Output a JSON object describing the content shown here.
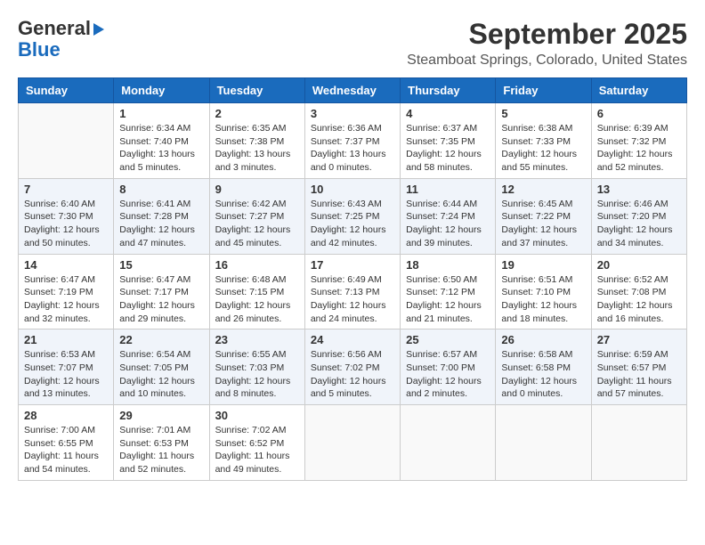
{
  "logo": {
    "line1": "General",
    "line2": "Blue"
  },
  "title": "September 2025",
  "subtitle": "Steamboat Springs, Colorado, United States",
  "weekdays": [
    "Sunday",
    "Monday",
    "Tuesday",
    "Wednesday",
    "Thursday",
    "Friday",
    "Saturday"
  ],
  "weeks": [
    [
      {
        "day": "",
        "info": ""
      },
      {
        "day": "1",
        "info": "Sunrise: 6:34 AM\nSunset: 7:40 PM\nDaylight: 13 hours\nand 5 minutes."
      },
      {
        "day": "2",
        "info": "Sunrise: 6:35 AM\nSunset: 7:38 PM\nDaylight: 13 hours\nand 3 minutes."
      },
      {
        "day": "3",
        "info": "Sunrise: 6:36 AM\nSunset: 7:37 PM\nDaylight: 13 hours\nand 0 minutes."
      },
      {
        "day": "4",
        "info": "Sunrise: 6:37 AM\nSunset: 7:35 PM\nDaylight: 12 hours\nand 58 minutes."
      },
      {
        "day": "5",
        "info": "Sunrise: 6:38 AM\nSunset: 7:33 PM\nDaylight: 12 hours\nand 55 minutes."
      },
      {
        "day": "6",
        "info": "Sunrise: 6:39 AM\nSunset: 7:32 PM\nDaylight: 12 hours\nand 52 minutes."
      }
    ],
    [
      {
        "day": "7",
        "info": "Sunrise: 6:40 AM\nSunset: 7:30 PM\nDaylight: 12 hours\nand 50 minutes."
      },
      {
        "day": "8",
        "info": "Sunrise: 6:41 AM\nSunset: 7:28 PM\nDaylight: 12 hours\nand 47 minutes."
      },
      {
        "day": "9",
        "info": "Sunrise: 6:42 AM\nSunset: 7:27 PM\nDaylight: 12 hours\nand 45 minutes."
      },
      {
        "day": "10",
        "info": "Sunrise: 6:43 AM\nSunset: 7:25 PM\nDaylight: 12 hours\nand 42 minutes."
      },
      {
        "day": "11",
        "info": "Sunrise: 6:44 AM\nSunset: 7:24 PM\nDaylight: 12 hours\nand 39 minutes."
      },
      {
        "day": "12",
        "info": "Sunrise: 6:45 AM\nSunset: 7:22 PM\nDaylight: 12 hours\nand 37 minutes."
      },
      {
        "day": "13",
        "info": "Sunrise: 6:46 AM\nSunset: 7:20 PM\nDaylight: 12 hours\nand 34 minutes."
      }
    ],
    [
      {
        "day": "14",
        "info": "Sunrise: 6:47 AM\nSunset: 7:19 PM\nDaylight: 12 hours\nand 32 minutes."
      },
      {
        "day": "15",
        "info": "Sunrise: 6:47 AM\nSunset: 7:17 PM\nDaylight: 12 hours\nand 29 minutes."
      },
      {
        "day": "16",
        "info": "Sunrise: 6:48 AM\nSunset: 7:15 PM\nDaylight: 12 hours\nand 26 minutes."
      },
      {
        "day": "17",
        "info": "Sunrise: 6:49 AM\nSunset: 7:13 PM\nDaylight: 12 hours\nand 24 minutes."
      },
      {
        "day": "18",
        "info": "Sunrise: 6:50 AM\nSunset: 7:12 PM\nDaylight: 12 hours\nand 21 minutes."
      },
      {
        "day": "19",
        "info": "Sunrise: 6:51 AM\nSunset: 7:10 PM\nDaylight: 12 hours\nand 18 minutes."
      },
      {
        "day": "20",
        "info": "Sunrise: 6:52 AM\nSunset: 7:08 PM\nDaylight: 12 hours\nand 16 minutes."
      }
    ],
    [
      {
        "day": "21",
        "info": "Sunrise: 6:53 AM\nSunset: 7:07 PM\nDaylight: 12 hours\nand 13 minutes."
      },
      {
        "day": "22",
        "info": "Sunrise: 6:54 AM\nSunset: 7:05 PM\nDaylight: 12 hours\nand 10 minutes."
      },
      {
        "day": "23",
        "info": "Sunrise: 6:55 AM\nSunset: 7:03 PM\nDaylight: 12 hours\nand 8 minutes."
      },
      {
        "day": "24",
        "info": "Sunrise: 6:56 AM\nSunset: 7:02 PM\nDaylight: 12 hours\nand 5 minutes."
      },
      {
        "day": "25",
        "info": "Sunrise: 6:57 AM\nSunset: 7:00 PM\nDaylight: 12 hours\nand 2 minutes."
      },
      {
        "day": "26",
        "info": "Sunrise: 6:58 AM\nSunset: 6:58 PM\nDaylight: 12 hours\nand 0 minutes."
      },
      {
        "day": "27",
        "info": "Sunrise: 6:59 AM\nSunset: 6:57 PM\nDaylight: 11 hours\nand 57 minutes."
      }
    ],
    [
      {
        "day": "28",
        "info": "Sunrise: 7:00 AM\nSunset: 6:55 PM\nDaylight: 11 hours\nand 54 minutes."
      },
      {
        "day": "29",
        "info": "Sunrise: 7:01 AM\nSunset: 6:53 PM\nDaylight: 11 hours\nand 52 minutes."
      },
      {
        "day": "30",
        "info": "Sunrise: 7:02 AM\nSunset: 6:52 PM\nDaylight: 11 hours\nand 49 minutes."
      },
      {
        "day": "",
        "info": ""
      },
      {
        "day": "",
        "info": ""
      },
      {
        "day": "",
        "info": ""
      },
      {
        "day": "",
        "info": ""
      }
    ]
  ]
}
